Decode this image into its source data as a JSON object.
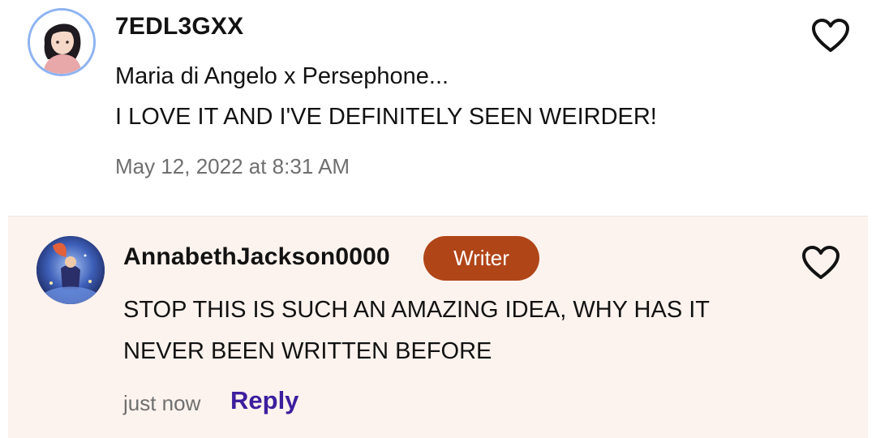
{
  "comment": {
    "username": "7EDL3GXX",
    "lines": [
      "Maria di Angelo x Persephone...",
      "I LOVE IT AND I'VE DEFINITELY SEEN WEIRDER!"
    ],
    "timestamp": "May 12, 2022 at 8:31 AM",
    "like_icon": "heart-outline-icon"
  },
  "reply": {
    "username": "AnnabethJackson0000",
    "badge": "Writer",
    "lines": [
      "STOP THIS IS SUCH AN AMAZING IDEA, WHY HAS IT",
      "NEVER BEEN WRITTEN BEFORE"
    ],
    "timestamp": "just now",
    "reply_label": "Reply",
    "like_icon": "heart-outline-icon"
  },
  "colors": {
    "badge_bg": "#b04518",
    "reply_link": "#3b1f9e",
    "reply_bg": "#fdf3ee",
    "muted_text": "#6f6f6f"
  }
}
